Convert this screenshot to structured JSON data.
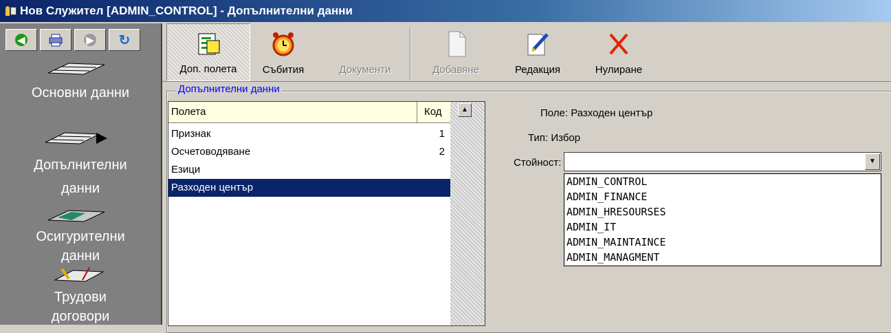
{
  "window": {
    "title": "Нов Служител [ADMIN_CONTROL] - Допълнителни данни"
  },
  "sidebar": {
    "items": [
      {
        "label": "Основни данни"
      },
      {
        "label": "Допълнителни данни"
      },
      {
        "label": "Осигурителни данни"
      },
      {
        "label": "Трудови договори"
      }
    ]
  },
  "toolbar": {
    "buttons": [
      {
        "label": "Доп. полета"
      },
      {
        "label": "Събития"
      },
      {
        "label": "Документи"
      },
      {
        "label": "Добавяне"
      },
      {
        "label": "Редакция"
      },
      {
        "label": "Нулиране"
      }
    ]
  },
  "group": {
    "title": "Допълнителни данни"
  },
  "fields_table": {
    "columns": [
      "Полета",
      "Код"
    ],
    "rows": [
      {
        "name": "Признак",
        "code": "1"
      },
      {
        "name": "Осчетоводяване",
        "code": "2"
      },
      {
        "name": "Езици",
        "code": ""
      },
      {
        "name": "Разходен център",
        "code": ""
      }
    ]
  },
  "details": {
    "field_text": "Поле: Разходен център",
    "type_text": "Тип: Избор",
    "value_label": "Стойност:",
    "value": "",
    "options": [
      "ADMIN_CONTROL",
      "ADMIN_FINANCE",
      "ADMIN_HRESOURSES",
      "ADMIN_IT",
      "ADMIN_MAINTAINCE",
      "ADMIN_MANAGMENT"
    ]
  },
  "colors": {
    "selection": "#0a246a",
    "group_title": "#0000ff",
    "sidebar_bg": "#808080"
  }
}
